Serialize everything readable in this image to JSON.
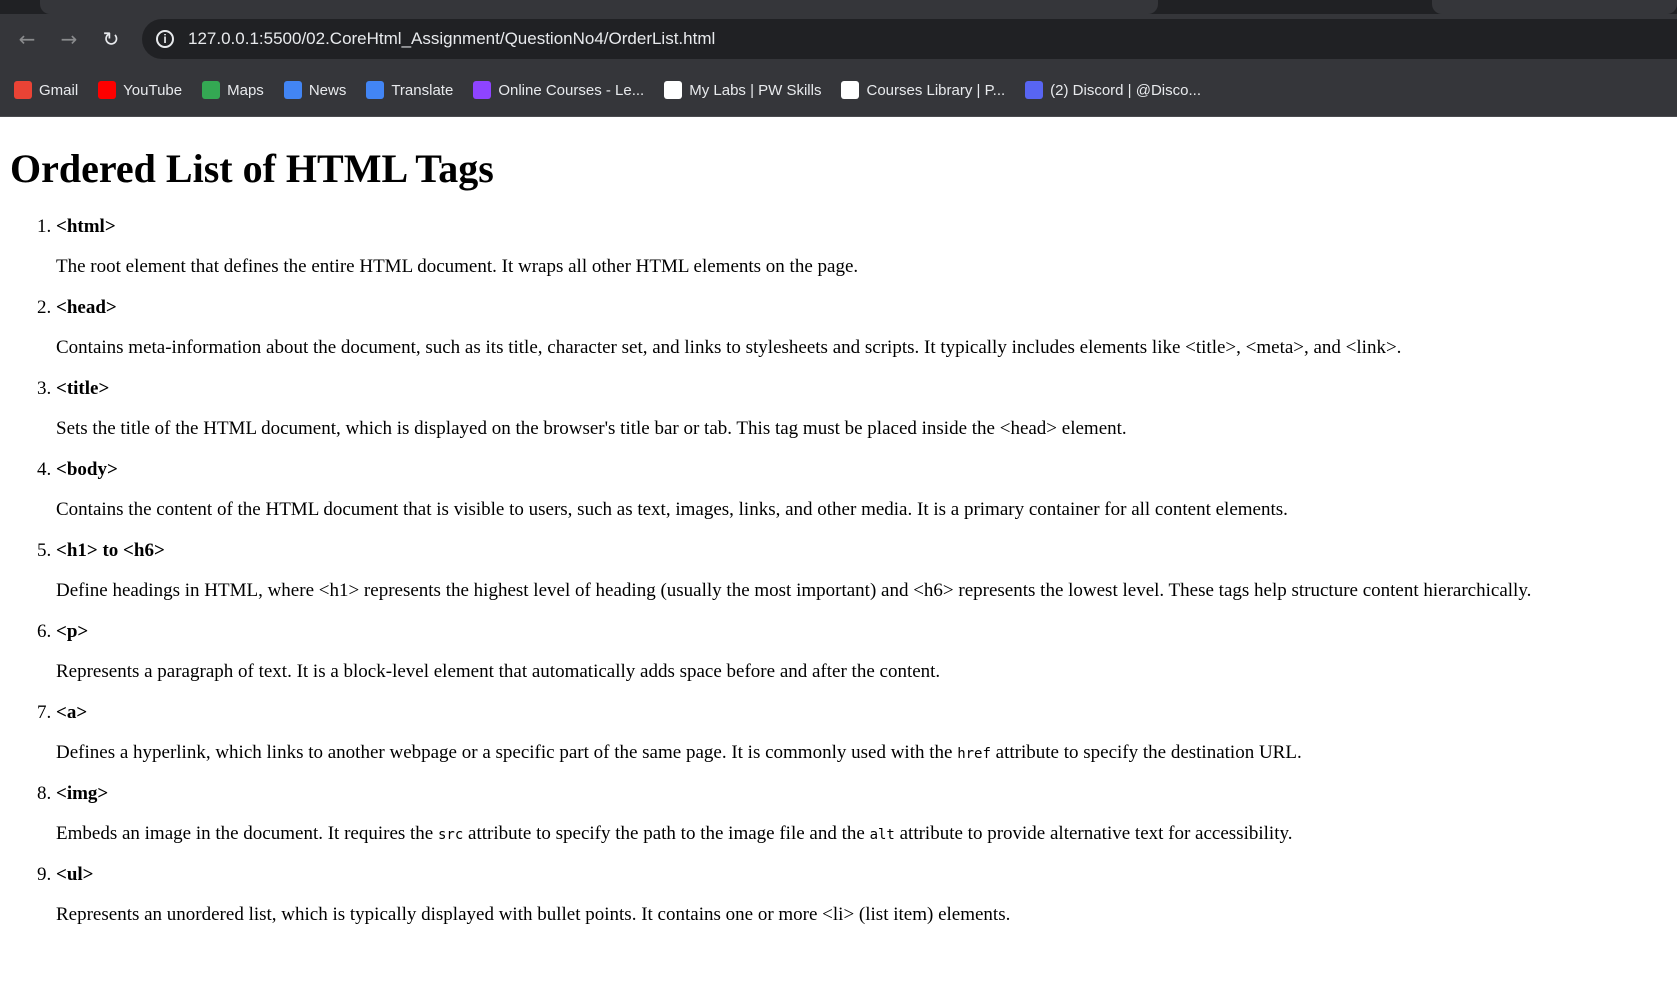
{
  "browser": {
    "url": "127.0.0.1:5500/02.CoreHtml_Assignment/QuestionNo4/OrderList.html",
    "bookmarks": [
      {
        "label": "Gmail",
        "icon": "gmail-icon",
        "color": "#ea4335"
      },
      {
        "label": "YouTube",
        "icon": "youtube-icon",
        "color": "#ff0000"
      },
      {
        "label": "Maps",
        "icon": "maps-icon",
        "color": "#34a853"
      },
      {
        "label": "News",
        "icon": "news-icon",
        "color": "#4285f4"
      },
      {
        "label": "Translate",
        "icon": "translate-icon",
        "color": "#4285f4"
      },
      {
        "label": "Online Courses - Le...",
        "icon": "courses-icon",
        "color": "#8e44ff"
      },
      {
        "label": "My Labs | PW Skills",
        "icon": "pw-skills-icon",
        "color": "#ffffff"
      },
      {
        "label": "Courses Library | P...",
        "icon": "pw-library-icon",
        "color": "#ffffff"
      },
      {
        "label": "(2) Discord | @Disco...",
        "icon": "discord-icon",
        "color": "#5865f2"
      }
    ]
  },
  "page": {
    "title": "Ordered List of HTML Tags",
    "items": [
      {
        "tag": "<html>",
        "desc": "The root element that defines the entire HTML document. It wraps all other HTML elements on the page."
      },
      {
        "tag": "<head>",
        "desc": "Contains meta-information about the document, such as its title, character set, and links to stylesheets and scripts. It typically includes elements like <title>, <meta>, and <link>."
      },
      {
        "tag": "<title>",
        "desc": "Sets the title of the HTML document, which is displayed on the browser's title bar or tab. This tag must be placed inside the <head> element."
      },
      {
        "tag": "<body>",
        "desc": "Contains the content of the HTML document that is visible to users, such as text, images, links, and other media. It is a primary container for all content elements."
      },
      {
        "tag": "<h1> to <h6>",
        "desc": "Define headings in HTML, where <h1> represents the highest level of heading (usually the most important) and <h6> represents the lowest level. These tags help structure content hierarchically."
      },
      {
        "tag": "<p>",
        "desc": "Represents a paragraph of text. It is a block-level element that automatically adds space before and after the content."
      },
      {
        "tag": "<a>",
        "desc_parts": [
          "Defines a hyperlink, which links to another webpage or a specific part of the same page. It is commonly used with the ",
          "href",
          " attribute to specify the destination URL."
        ]
      },
      {
        "tag": "<img>",
        "desc_parts": [
          "Embeds an image in the document. It requires the ",
          "src",
          " attribute to specify the path to the image file and the ",
          "alt",
          " attribute to provide alternative text for accessibility."
        ]
      },
      {
        "tag": "<ul>",
        "desc": "Represents an unordered list, which is typically displayed with bullet points. It contains one or more <li> (list item) elements."
      }
    ]
  }
}
